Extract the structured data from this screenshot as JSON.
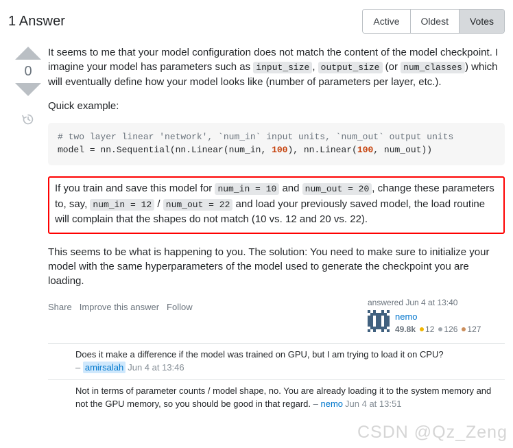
{
  "header": {
    "title": "1 Answer",
    "sort_options": [
      {
        "label": "Active",
        "selected": false
      },
      {
        "label": "Oldest",
        "selected": false
      },
      {
        "label": "Votes",
        "selected": true
      }
    ]
  },
  "vote": {
    "count": "0",
    "up_icon": "triangle-up-icon",
    "down_icon": "triangle-down-icon",
    "history_icon": "history-clock-icon"
  },
  "answer": {
    "paragraph1": {
      "part1": "It seems to me that your model configuration does not match the content of the model checkpoint. I imagine your model has parameters such as ",
      "code1": "input_size",
      "sep1": ", ",
      "code2": "output_size",
      "part2": " (or ",
      "code3": "num_classes",
      "part3": ") which will eventually define how your model looks like (number of parameters per layer, etc.)."
    },
    "paragraph2": "Quick example:",
    "codeblock": {
      "comment_line": "# two layer linear 'network', `num_in` input units, `num_out` output units",
      "line2_a": "model = nn.Sequential(nn.Linear(num_in, ",
      "line2_num1": "100",
      "line2_b": "), nn.Linear(",
      "line2_num2": "100",
      "line2_c": ", num_out))"
    },
    "highlight": {
      "part1": "If you train and save this model for ",
      "code1": "num_in = 10",
      "part2": " and ",
      "code2": "num_out = 20",
      "part3": ", change these parameters to, say, ",
      "code3": "num_in = 12",
      "part4": " / ",
      "code4": "num_out = 22",
      "part5": " and load your previously saved model, the load routine will complain that the shapes do not match (10 vs. 12 and 20 vs. 22).",
      "border_color": "#fe0000"
    },
    "paragraph3": "This seems to be what is happening to you. The solution: You need to make sure to initialize your model with the same hyperparameters of the model used to generate the checkpoint you are loading."
  },
  "actions": {
    "share": "Share",
    "improve": "Improve this answer",
    "follow": "Follow"
  },
  "author": {
    "action_time": "answered Jun 4 at 13:40",
    "name": "nemo",
    "reputation": "49.8k",
    "badges": [
      {
        "type": "gold",
        "count": "12",
        "color": "#f1b600"
      },
      {
        "type": "silver",
        "count": "126",
        "color": "#9fa6ad"
      },
      {
        "type": "bronze",
        "count": "127",
        "color": "#cb8e5b"
      }
    ],
    "avatar_icon": "identicon-avatar"
  },
  "comments": [
    {
      "text": "Does it make a difference if the model was trained on GPU, but I am trying to load it on CPU?",
      "dash": "–",
      "user": "amirsalah",
      "user_highlighted": true,
      "time": "Jun 4 at 13:46",
      "inline": false
    },
    {
      "text": "Not in terms of parameter counts / model shape, no. You are already loading it to the system memory and not the GPU memory, so you should be good in that regard.",
      "dash": "–",
      "user": "nemo",
      "user_highlighted": false,
      "time": "Jun 4 at 13:51",
      "inline": true
    }
  ],
  "watermark": "CSDN @Qz_Zeng"
}
